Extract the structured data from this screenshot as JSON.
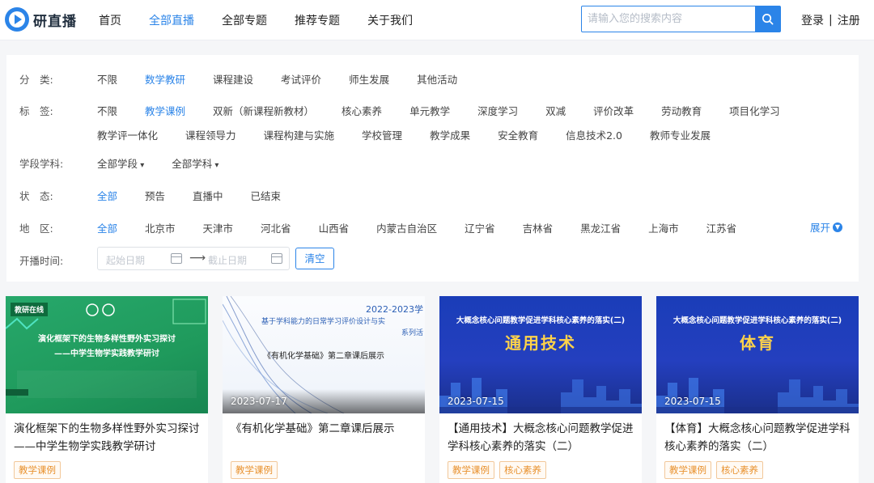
{
  "brand": {
    "name": "研直播"
  },
  "nav": {
    "items": [
      "首页",
      "全部直播",
      "全部专题",
      "推荐专题",
      "关于我们"
    ],
    "active_index": 1
  },
  "search": {
    "placeholder": "请输入您的搜索内容"
  },
  "auth": {
    "login": "登录",
    "separator": "|",
    "register": "注册"
  },
  "filters": {
    "category": {
      "label": "分　类:",
      "options": [
        "不限",
        "数学教研",
        "课程建设",
        "考试评价",
        "师生发展",
        "其他活动"
      ],
      "active": "数学教研"
    },
    "tags": {
      "label": "标　签:",
      "options": [
        "不限",
        "教学课例",
        "双新（新课程新教材）",
        "核心素养",
        "单元教学",
        "深度学习",
        "双减",
        "评价改革",
        "劳动教育",
        "项目化学习",
        "教学评一体化",
        "课程领导力",
        "课程构建与实施",
        "学校管理",
        "教学成果",
        "安全教育",
        "信息技术2.0",
        "教师专业发展"
      ],
      "active": "教学课例"
    },
    "stage": {
      "label": "学段学科:",
      "options": [
        "全部学段",
        "全部学科"
      ]
    },
    "status": {
      "label": "状　态:",
      "options": [
        "全部",
        "预告",
        "直播中",
        "已结束"
      ],
      "active": "全部"
    },
    "region": {
      "label": "地　区:",
      "options": [
        "全部",
        "北京市",
        "天津市",
        "河北省",
        "山西省",
        "内蒙古自治区",
        "辽宁省",
        "吉林省",
        "黑龙江省",
        "上海市",
        "江苏省"
      ],
      "active": "全部",
      "expand": "展开"
    },
    "time": {
      "label": "开播时间:",
      "start_placeholder": "起始日期",
      "end_placeholder": "截止日期",
      "clear": "清空"
    }
  },
  "cards": [
    {
      "date": "",
      "title": "演化框架下的生物多样性野外实习探讨——中学生物学实践教学研讨",
      "tags": [
        "教学课例"
      ],
      "thumb_style": "green",
      "thumb_text": [
        "演化框架下的生物多样性野外实习探讨",
        "——中学生物学实践教学研讨"
      ],
      "thumb_badge": "教研在线"
    },
    {
      "date": "2023-07-17",
      "title": "《有机化学基础》第二章课后展示",
      "tags": [
        "教学课例"
      ],
      "thumb_style": "white",
      "thumb_text": [
        "2022-2023学",
        "基于学科能力的日常学习评价设计与实",
        "系列活",
        "《有机化学基础》第二章课后展示"
      ]
    },
    {
      "date": "2023-07-15",
      "title": "【通用技术】大概念核心问题教学促进学科核心素养的落实（二）",
      "tags": [
        "教学课例",
        "核心素养"
      ],
      "thumb_style": "blue",
      "thumb_text": [
        "大概念核心问题教学促进学科核心素养的落实(二)",
        "通用技术"
      ]
    },
    {
      "date": "2023-07-15",
      "title": "【体育】大概念核心问题教学促进学科核心素养的落实（二）",
      "tags": [
        "教学课例",
        "核心素养"
      ],
      "thumb_style": "blue",
      "thumb_text": [
        "大概念核心问题教学促进学科核心素养的落实(二)",
        "体育"
      ]
    }
  ],
  "colors": {
    "accent": "#2b84e8",
    "tag_text": "#e8912e",
    "tag_border": "#f2c89a",
    "thumb_green": "#1f9a5c",
    "thumb_blue": "#243fbf"
  },
  "icons": {
    "logo": "play-logo-icon",
    "search": "search-icon",
    "calendar": "calendar-icon",
    "expand": "chevron-down-circle-icon",
    "arrow": "arrow-right-icon"
  }
}
